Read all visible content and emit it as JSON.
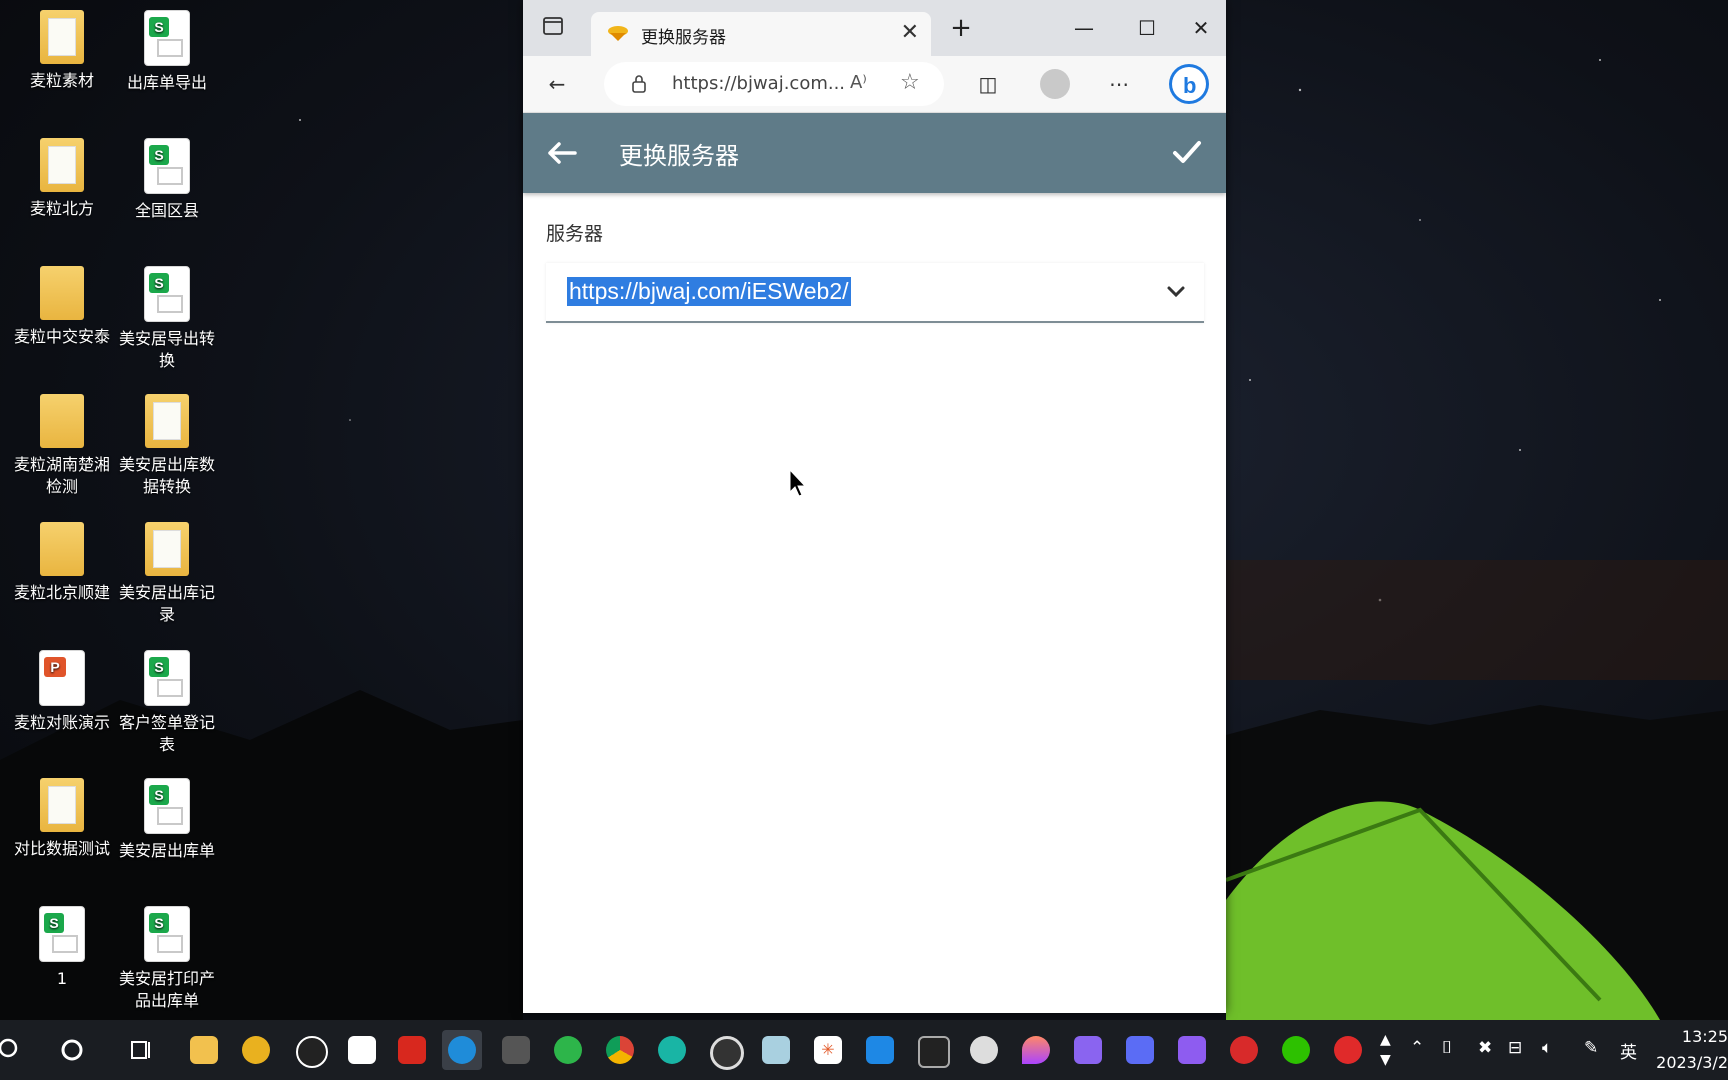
{
  "desktop": {
    "icons": [
      {
        "label": "麦粒素材",
        "type": "folder-doc"
      },
      {
        "label": "出库单导出",
        "type": "sheet"
      },
      {
        "label": "麦粒北方",
        "type": "folder-doc"
      },
      {
        "label": "全国区县",
        "type": "sheet"
      },
      {
        "label": "麦粒中交安泰",
        "type": "folder"
      },
      {
        "label": "美安居导出转换",
        "type": "sheet"
      },
      {
        "label": "麦粒湖南楚湘检测",
        "type": "folder"
      },
      {
        "label": "美安居出库数据转换",
        "type": "folder-sheet"
      },
      {
        "label": "麦粒北京顺建",
        "type": "folder"
      },
      {
        "label": "美安居出库记录",
        "type": "folder-sheet"
      },
      {
        "label": "麦粒对账演示",
        "type": "ppt"
      },
      {
        "label": "客户签单登记表",
        "type": "sheet"
      },
      {
        "label": "对比数据测试",
        "type": "folder-doc"
      },
      {
        "label": "美安居出库单",
        "type": "sheet"
      },
      {
        "label": "1",
        "type": "sheet"
      },
      {
        "label": "美安居打印产品出库单",
        "type": "sheet"
      }
    ]
  },
  "browser": {
    "tab_title": "更换服务器",
    "address": "https://bjwaj.com...",
    "icons": [
      "tab-actions-icon",
      "close-tab-icon",
      "new-tab-icon",
      "minimize-icon",
      "maximize-icon",
      "close-window-icon",
      "back-icon",
      "lock-icon",
      "read-aloud-icon",
      "favorite-icon",
      "split-screen-icon",
      "profile-icon",
      "more-icon",
      "bing-icon"
    ]
  },
  "app": {
    "title": "更换服务器",
    "server_label": "服务器",
    "server_value": "https://bjwaj.com/iESWeb2/"
  },
  "taskbar": {
    "ime": "英",
    "time": "13:25",
    "date": "2023/3/2",
    "accent": "#5f7b88"
  }
}
